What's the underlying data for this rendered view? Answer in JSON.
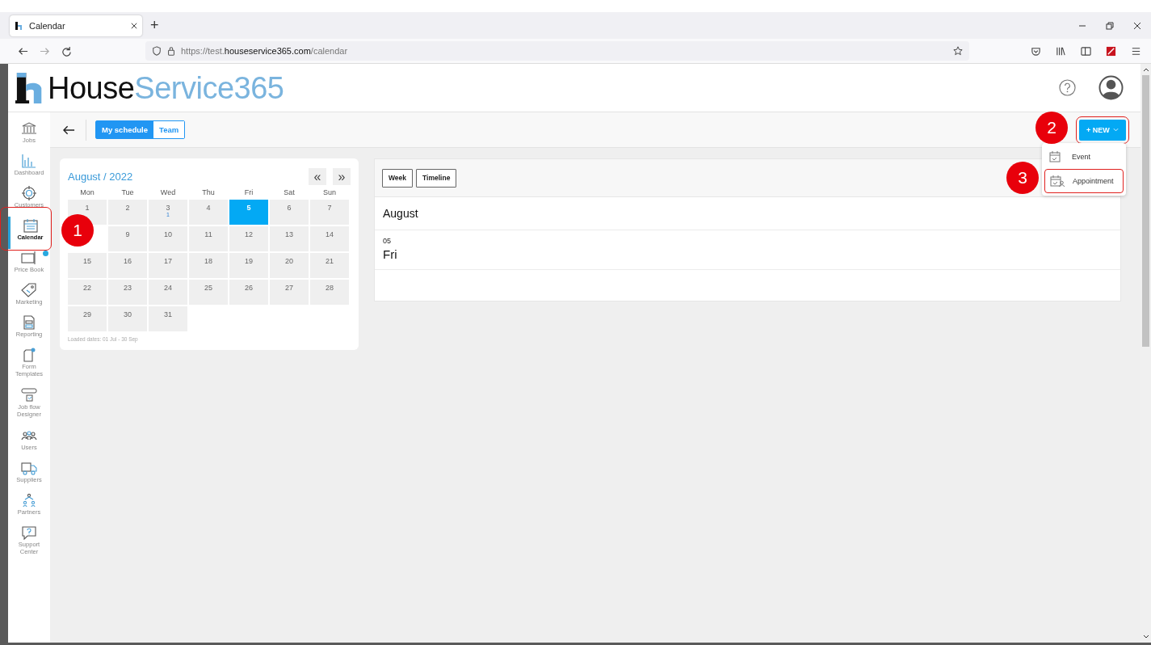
{
  "browser": {
    "tab_title": "Calendar",
    "new_tab": "+",
    "url_prefix": "https://test.",
    "url_domain": "houseservice365.com",
    "url_path": "/calendar"
  },
  "logo": {
    "part_1": "House",
    "part_2": "Service365"
  },
  "sidebar": [
    {
      "label": "Jobs",
      "selected": false,
      "badge": false,
      "outlined": false
    },
    {
      "label": "Dashboard",
      "selected": false,
      "badge": false,
      "outlined": false
    },
    {
      "label": "Customers",
      "selected": false,
      "badge": false,
      "outlined": false
    },
    {
      "label": "Calendar",
      "selected": true,
      "badge": false,
      "outlined": true
    },
    {
      "label": "Price Book",
      "selected": false,
      "badge": true,
      "outlined": false
    },
    {
      "label": "Marketing",
      "selected": false,
      "badge": false,
      "outlined": false
    },
    {
      "label": "Reporting",
      "selected": false,
      "badge": false,
      "outlined": false
    },
    {
      "label": "Form Templates",
      "selected": false,
      "badge": false,
      "outlined": false
    },
    {
      "label": "Job flow Designer",
      "selected": false,
      "badge": false,
      "outlined": false
    },
    {
      "label": "Users",
      "selected": false,
      "badge": false,
      "outlined": false
    },
    {
      "label": "Suppliers",
      "selected": false,
      "badge": false,
      "outlined": false
    },
    {
      "label": "Partners",
      "selected": false,
      "badge": false,
      "outlined": false
    },
    {
      "label": "Support Center",
      "selected": false,
      "badge": false,
      "outlined": false
    }
  ],
  "toolbar": {
    "view_toggle": [
      {
        "label": "My schedule",
        "selected": true
      },
      {
        "label": "Team",
        "selected": false
      }
    ],
    "new_button": {
      "label": "+ NEW",
      "outlined": true
    }
  },
  "new_menu": [
    {
      "label": "Event",
      "outlined": false
    },
    {
      "label": "Appointment",
      "outlined": true
    }
  ],
  "calendar": {
    "title": "August / 2022",
    "prev": "«",
    "next": "»",
    "weekdays": [
      "Mon",
      "Tue",
      "Wed",
      "Thu",
      "Fri",
      "Sat",
      "Sun"
    ],
    "weeks": [
      [
        {
          "day": "1",
          "selected": false
        },
        {
          "day": "2",
          "selected": false
        },
        {
          "day": "3",
          "selected": false,
          "count": "1"
        },
        {
          "day": "4",
          "selected": false
        },
        {
          "day": "5",
          "selected": true
        },
        {
          "day": "6",
          "selected": false
        },
        {
          "day": "7",
          "selected": false
        }
      ],
      [
        {
          "day": "9",
          "selected": false
        },
        {
          "day": "10",
          "selected": false
        },
        {
          "day": "11",
          "selected": false
        },
        {
          "day": "12",
          "selected": false
        },
        {
          "day": "13",
          "selected": false
        },
        {
          "day": "14",
          "selected": false
        }
      ],
      [
        {
          "day": "15",
          "selected": false
        },
        {
          "day": "16",
          "selected": false
        },
        {
          "day": "17",
          "selected": false
        },
        {
          "day": "18",
          "selected": false
        },
        {
          "day": "19",
          "selected": false
        },
        {
          "day": "20",
          "selected": false
        },
        {
          "day": "21",
          "selected": false
        }
      ],
      [
        {
          "day": "22",
          "selected": false
        },
        {
          "day": "23",
          "selected": false
        },
        {
          "day": "24",
          "selected": false
        },
        {
          "day": "25",
          "selected": false
        },
        {
          "day": "26",
          "selected": false
        },
        {
          "day": "27",
          "selected": false
        },
        {
          "day": "28",
          "selected": false
        }
      ],
      [
        {
          "day": "29",
          "selected": false
        },
        {
          "day": "30",
          "selected": false
        },
        {
          "day": "31",
          "selected": false
        }
      ]
    ],
    "footer": "Loaded dates: 01 Jul - 30 Sep"
  },
  "agenda": {
    "view_buttons": [
      "Week",
      "Timeline"
    ],
    "month": "August",
    "day_number": "05",
    "day_name": "Fri"
  },
  "annotations": [
    "1",
    "2",
    "3"
  ]
}
